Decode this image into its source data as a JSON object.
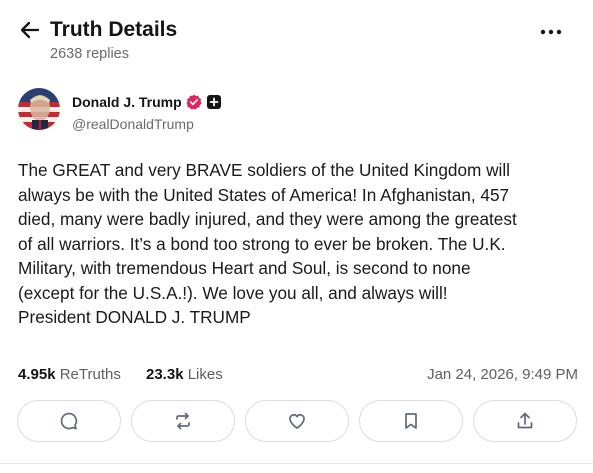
{
  "header": {
    "title": "Truth Details",
    "subtitle": "2638 replies"
  },
  "author": {
    "name": "Donald J. Trump",
    "handle": "@realDonaldTrump"
  },
  "post": {
    "text": "The GREAT and very BRAVE soldiers of the United Kingdom will\nalways be with the United States of America! In Afghanistan, 457\ndied, many were badly injured, and they were among the greatest\nof all warriors. It’s a bond too strong to ever be broken. The U.K.\nMilitary, with tremendous Heart and Soul, is second to none\n(except for the U.S.A.!). We love you all, and always will!\nPresident DONALD J. TRUMP"
  },
  "stats": {
    "retruths_count": "4.95k",
    "retruths_label": "ReTruths",
    "likes_count": "23.3k",
    "likes_label": "Likes",
    "timestamp": "Jan 24, 2026, 9:49 PM"
  },
  "icons": {
    "back": "arrow-left-icon",
    "more": "ellipsis-icon",
    "verified": "verified-badge-icon",
    "plus": "plus-badge-icon",
    "reply": "comment-icon",
    "retruth": "repost-icon",
    "like": "heart-icon",
    "bookmark": "bookmark-icon",
    "share": "share-icon"
  },
  "colors": {
    "verified": "#e0245e",
    "text": "#141414",
    "muted": "#6b6b6b"
  }
}
